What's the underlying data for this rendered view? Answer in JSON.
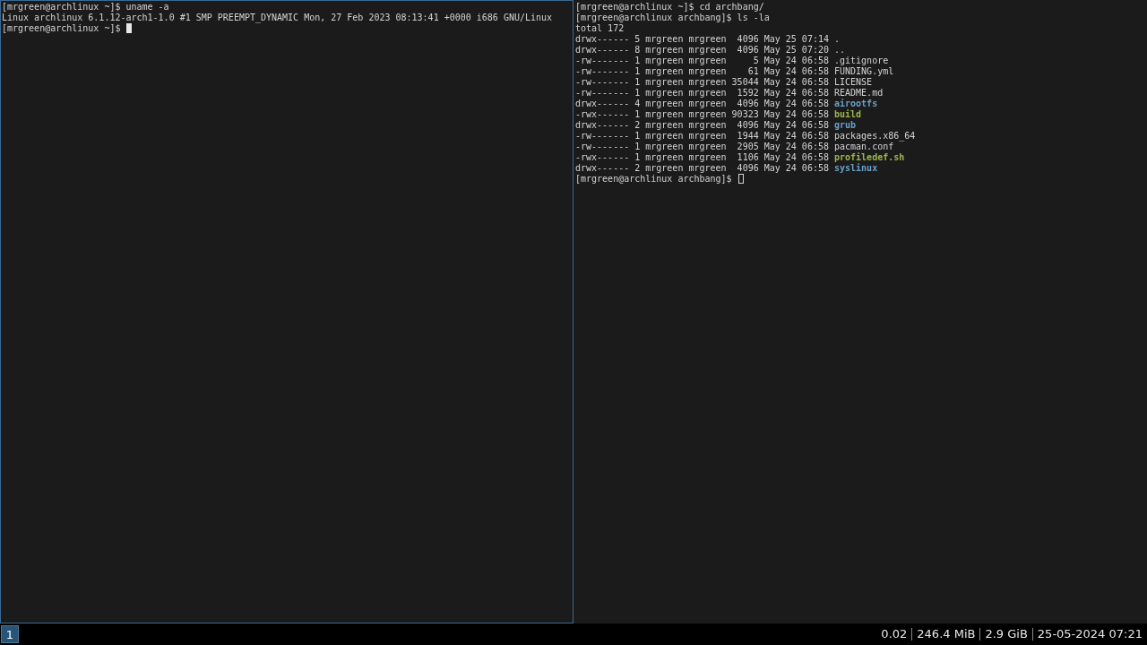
{
  "panes": [
    {
      "focused": true,
      "lines": [
        "[mrgreen@archlinux ~]$ uname -a",
        "Linux archlinux 6.1.12-arch1-1.0 #1 SMP PREEMPT_DYNAMIC Mon, 27 Feb 2023 08:13:41 +0000 i686 GNU/Linux"
      ],
      "prompt": "[mrgreen@archlinux ~]$"
    },
    {
      "focused": false,
      "lines": [
        "[mrgreen@archlinux ~]$ cd archbang/",
        "[mrgreen@archlinux archbang]$ ls -la",
        "total 172"
      ],
      "entries": [
        {
          "info": "drwx------ 5 mrgreen mrgreen  4096 May 25 07:14",
          "name": ".",
          "kind": "plain"
        },
        {
          "info": "drwx------ 8 mrgreen mrgreen  4096 May 25 07:20",
          "name": "..",
          "kind": "plain"
        },
        {
          "info": "-rw------- 1 mrgreen mrgreen     5 May 24 06:58",
          "name": ".gitignore",
          "kind": "plain"
        },
        {
          "info": "-rw------- 1 mrgreen mrgreen    61 May 24 06:58",
          "name": "FUNDING.yml",
          "kind": "plain"
        },
        {
          "info": "-rw------- 1 mrgreen mrgreen 35044 May 24 06:58",
          "name": "LICENSE",
          "kind": "plain"
        },
        {
          "info": "-rw------- 1 mrgreen mrgreen  1592 May 24 06:58",
          "name": "README.md",
          "kind": "plain"
        },
        {
          "info": "drwx------ 4 mrgreen mrgreen  4096 May 24 06:58",
          "name": "airootfs",
          "kind": "dir"
        },
        {
          "info": "-rwx------ 1 mrgreen mrgreen 90323 May 24 06:58",
          "name": "build",
          "kind": "exec"
        },
        {
          "info": "drwx------ 2 mrgreen mrgreen  4096 May 24 06:58",
          "name": "grub",
          "kind": "dir"
        },
        {
          "info": "-rw------- 1 mrgreen mrgreen  1944 May 24 06:58",
          "name": "packages.x86_64",
          "kind": "plain"
        },
        {
          "info": "-rw------- 1 mrgreen mrgreen  2905 May 24 06:58",
          "name": "pacman.conf",
          "kind": "plain"
        },
        {
          "info": "-rwx------ 1 mrgreen mrgreen  1106 May 24 06:58",
          "name": "profiledef.sh",
          "kind": "exec"
        },
        {
          "info": "drwx------ 2 mrgreen mrgreen  4096 May 24 06:58",
          "name": "syslinux",
          "kind": "dir"
        }
      ],
      "prompt": "[mrgreen@archlinux archbang]$"
    }
  ],
  "workspaces": [
    {
      "label": "1",
      "selected": true
    }
  ],
  "status": [
    "0.02",
    "246.4 MiB",
    "2.9 GiB",
    "25-05-2024 07:21"
  ]
}
